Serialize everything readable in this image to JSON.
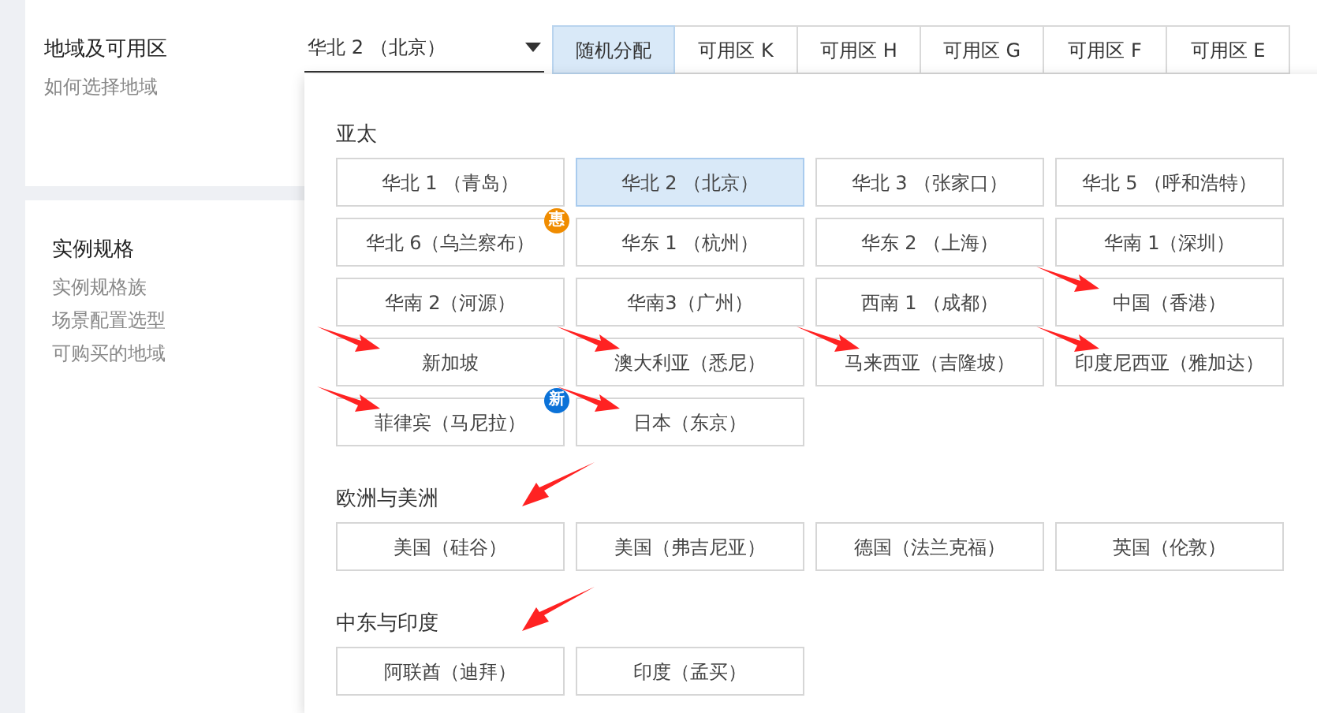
{
  "region_section": {
    "title": "地域及可用区",
    "help_link": "如何选择地域"
  },
  "spec_section": {
    "title": "实例规格",
    "links": [
      "实例规格族",
      "场景配置选型",
      "可购买的地域"
    ]
  },
  "region_select": {
    "value": "华北 2 （北京）"
  },
  "zone_tabs": [
    {
      "label": "随机分配",
      "selected": true
    },
    {
      "label": "可用区 K",
      "selected": false
    },
    {
      "label": "可用区 H",
      "selected": false
    },
    {
      "label": "可用区 G",
      "selected": false
    },
    {
      "label": "可用区 F",
      "selected": false
    },
    {
      "label": "可用区 E",
      "selected": false
    }
  ],
  "dropdown": {
    "groups": [
      {
        "title": "亚太",
        "marked": false,
        "regions": [
          {
            "label": "华北 1 （青岛）",
            "selected": false,
            "marked": false
          },
          {
            "label": "华北 2 （北京）",
            "selected": true,
            "marked": false
          },
          {
            "label": "华北 3 （张家口）",
            "selected": false,
            "marked": false
          },
          {
            "label": "华北 5 （呼和浩特）",
            "selected": false,
            "marked": false
          },
          {
            "label": "华北 6（乌兰察布）",
            "selected": false,
            "marked": false,
            "badge": "惠",
            "color": "#f08c00"
          },
          {
            "label": "华东 1 （杭州）",
            "selected": false,
            "marked": false
          },
          {
            "label": "华东 2 （上海）",
            "selected": false,
            "marked": false
          },
          {
            "label": "华南 1（深圳）",
            "selected": false,
            "marked": false
          },
          {
            "label": "华南 2（河源）",
            "selected": false,
            "marked": false
          },
          {
            "label": "华南3（广州）",
            "selected": false,
            "marked": false
          },
          {
            "label": "西南 1 （成都）",
            "selected": false,
            "marked": false
          },
          {
            "label": "中国（香港）",
            "selected": false,
            "marked": true
          },
          {
            "label": "新加坡",
            "selected": false,
            "marked": true
          },
          {
            "label": "澳大利亚（悉尼）",
            "selected": false,
            "marked": true
          },
          {
            "label": "马来西亚（吉隆坡）",
            "selected": false,
            "marked": true
          },
          {
            "label": "印度尼西亚（雅加达）",
            "selected": false,
            "marked": true
          },
          {
            "label": "菲律宾（马尼拉）",
            "selected": false,
            "marked": true,
            "badge": "新",
            "color": "#0b72d8"
          },
          {
            "label": "日本（东京）",
            "selected": false,
            "marked": true
          }
        ]
      },
      {
        "title": "欧洲与美洲",
        "marked": true,
        "regions": [
          {
            "label": "美国（硅谷）",
            "selected": false,
            "marked": false
          },
          {
            "label": "美国（弗吉尼亚）",
            "selected": false,
            "marked": false
          },
          {
            "label": "德国（法兰克福）",
            "selected": false,
            "marked": false
          },
          {
            "label": "英国（伦敦）",
            "selected": false,
            "marked": false
          }
        ]
      },
      {
        "title": "中东与印度",
        "marked": true,
        "regions": [
          {
            "label": "阿联酋（迪拜）",
            "selected": false,
            "marked": false
          },
          {
            "label": "印度（孟买）",
            "selected": false,
            "marked": false
          }
        ]
      }
    ]
  }
}
